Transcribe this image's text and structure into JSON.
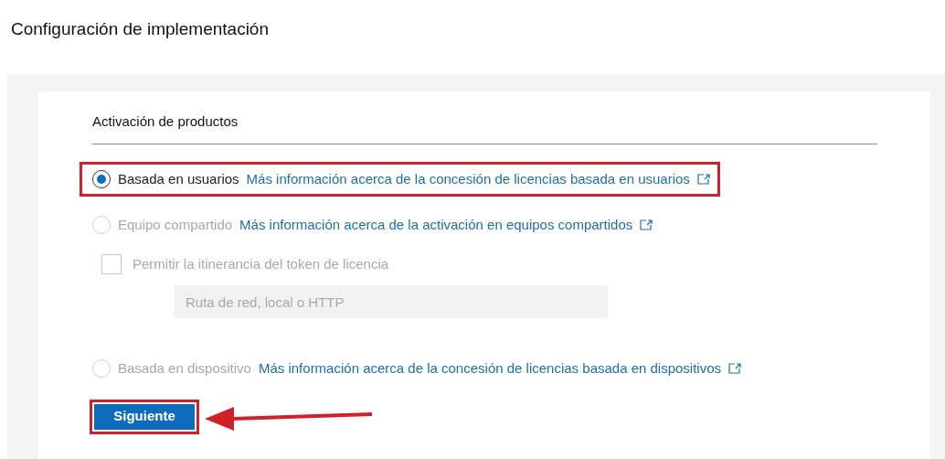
{
  "page_title": "Configuración de implementación",
  "section": {
    "heading": "Activación de productos",
    "options": [
      {
        "kind": "radio",
        "label": "Basada en usuarios",
        "link": "Más información acerca de la concesión de licencias basada en usuarios",
        "selected": true,
        "disabled": false,
        "highlighted": true
      },
      {
        "kind": "radio",
        "label": "Equipo compartido",
        "link": "Más información acerca de la activación en equipos compartidos",
        "selected": false,
        "disabled": true,
        "highlighted": false
      },
      {
        "kind": "checkbox",
        "label": "Permitir la itinerancia del token de licencia",
        "checked": false,
        "disabled": true,
        "placeholder": "Ruta de red, local o HTTP"
      },
      {
        "kind": "radio",
        "label": "Basada en dispositivo",
        "link": "Más información acerca de la concesión de licencias basada en dispositivos",
        "selected": false,
        "disabled": true,
        "highlighted": false
      }
    ]
  },
  "next_button": {
    "label": "Siguiente",
    "highlighted": true
  }
}
